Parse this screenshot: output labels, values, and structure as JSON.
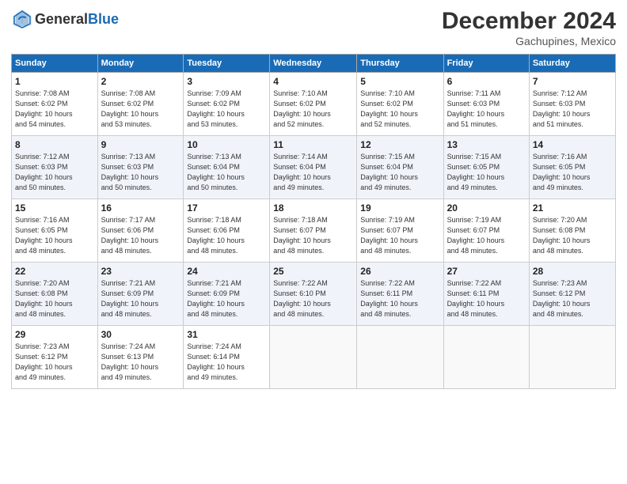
{
  "header": {
    "logo_line1": "General",
    "logo_line2": "Blue",
    "month_title": "December 2024",
    "location": "Gachupines, Mexico"
  },
  "weekdays": [
    "Sunday",
    "Monday",
    "Tuesday",
    "Wednesday",
    "Thursday",
    "Friday",
    "Saturday"
  ],
  "weeks": [
    [
      {
        "day": "1",
        "info": "Sunrise: 7:08 AM\nSunset: 6:02 PM\nDaylight: 10 hours\nand 54 minutes."
      },
      {
        "day": "2",
        "info": "Sunrise: 7:08 AM\nSunset: 6:02 PM\nDaylight: 10 hours\nand 53 minutes."
      },
      {
        "day": "3",
        "info": "Sunrise: 7:09 AM\nSunset: 6:02 PM\nDaylight: 10 hours\nand 53 minutes."
      },
      {
        "day": "4",
        "info": "Sunrise: 7:10 AM\nSunset: 6:02 PM\nDaylight: 10 hours\nand 52 minutes."
      },
      {
        "day": "5",
        "info": "Sunrise: 7:10 AM\nSunset: 6:02 PM\nDaylight: 10 hours\nand 52 minutes."
      },
      {
        "day": "6",
        "info": "Sunrise: 7:11 AM\nSunset: 6:03 PM\nDaylight: 10 hours\nand 51 minutes."
      },
      {
        "day": "7",
        "info": "Sunrise: 7:12 AM\nSunset: 6:03 PM\nDaylight: 10 hours\nand 51 minutes."
      }
    ],
    [
      {
        "day": "8",
        "info": "Sunrise: 7:12 AM\nSunset: 6:03 PM\nDaylight: 10 hours\nand 50 minutes."
      },
      {
        "day": "9",
        "info": "Sunrise: 7:13 AM\nSunset: 6:03 PM\nDaylight: 10 hours\nand 50 minutes."
      },
      {
        "day": "10",
        "info": "Sunrise: 7:13 AM\nSunset: 6:04 PM\nDaylight: 10 hours\nand 50 minutes."
      },
      {
        "day": "11",
        "info": "Sunrise: 7:14 AM\nSunset: 6:04 PM\nDaylight: 10 hours\nand 49 minutes."
      },
      {
        "day": "12",
        "info": "Sunrise: 7:15 AM\nSunset: 6:04 PM\nDaylight: 10 hours\nand 49 minutes."
      },
      {
        "day": "13",
        "info": "Sunrise: 7:15 AM\nSunset: 6:05 PM\nDaylight: 10 hours\nand 49 minutes."
      },
      {
        "day": "14",
        "info": "Sunrise: 7:16 AM\nSunset: 6:05 PM\nDaylight: 10 hours\nand 49 minutes."
      }
    ],
    [
      {
        "day": "15",
        "info": "Sunrise: 7:16 AM\nSunset: 6:05 PM\nDaylight: 10 hours\nand 48 minutes."
      },
      {
        "day": "16",
        "info": "Sunrise: 7:17 AM\nSunset: 6:06 PM\nDaylight: 10 hours\nand 48 minutes."
      },
      {
        "day": "17",
        "info": "Sunrise: 7:18 AM\nSunset: 6:06 PM\nDaylight: 10 hours\nand 48 minutes."
      },
      {
        "day": "18",
        "info": "Sunrise: 7:18 AM\nSunset: 6:07 PM\nDaylight: 10 hours\nand 48 minutes."
      },
      {
        "day": "19",
        "info": "Sunrise: 7:19 AM\nSunset: 6:07 PM\nDaylight: 10 hours\nand 48 minutes."
      },
      {
        "day": "20",
        "info": "Sunrise: 7:19 AM\nSunset: 6:07 PM\nDaylight: 10 hours\nand 48 minutes."
      },
      {
        "day": "21",
        "info": "Sunrise: 7:20 AM\nSunset: 6:08 PM\nDaylight: 10 hours\nand 48 minutes."
      }
    ],
    [
      {
        "day": "22",
        "info": "Sunrise: 7:20 AM\nSunset: 6:08 PM\nDaylight: 10 hours\nand 48 minutes."
      },
      {
        "day": "23",
        "info": "Sunrise: 7:21 AM\nSunset: 6:09 PM\nDaylight: 10 hours\nand 48 minutes."
      },
      {
        "day": "24",
        "info": "Sunrise: 7:21 AM\nSunset: 6:09 PM\nDaylight: 10 hours\nand 48 minutes."
      },
      {
        "day": "25",
        "info": "Sunrise: 7:22 AM\nSunset: 6:10 PM\nDaylight: 10 hours\nand 48 minutes."
      },
      {
        "day": "26",
        "info": "Sunrise: 7:22 AM\nSunset: 6:11 PM\nDaylight: 10 hours\nand 48 minutes."
      },
      {
        "day": "27",
        "info": "Sunrise: 7:22 AM\nSunset: 6:11 PM\nDaylight: 10 hours\nand 48 minutes."
      },
      {
        "day": "28",
        "info": "Sunrise: 7:23 AM\nSunset: 6:12 PM\nDaylight: 10 hours\nand 48 minutes."
      }
    ],
    [
      {
        "day": "29",
        "info": "Sunrise: 7:23 AM\nSunset: 6:12 PM\nDaylight: 10 hours\nand 49 minutes."
      },
      {
        "day": "30",
        "info": "Sunrise: 7:24 AM\nSunset: 6:13 PM\nDaylight: 10 hours\nand 49 minutes."
      },
      {
        "day": "31",
        "info": "Sunrise: 7:24 AM\nSunset: 6:14 PM\nDaylight: 10 hours\nand 49 minutes."
      },
      {
        "day": "",
        "info": ""
      },
      {
        "day": "",
        "info": ""
      },
      {
        "day": "",
        "info": ""
      },
      {
        "day": "",
        "info": ""
      }
    ]
  ]
}
